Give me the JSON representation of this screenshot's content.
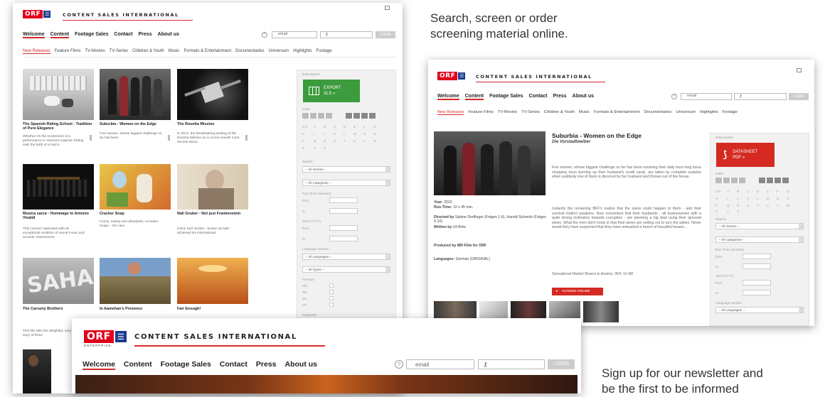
{
  "promo": {
    "top_text_1": "Search, screen or order",
    "top_text_2": "screening material online.",
    "bottom_text_1": "Sign up for our newsletter and",
    "bottom_text_2": "be the first to be informed"
  },
  "brand": {
    "orf": "ORF",
    "enterprise": "ENTERPRISE",
    "name": "CONTENT SALES INTERNATIONAL"
  },
  "nav": {
    "items": [
      "Welcome",
      "Content",
      "Footage Sales",
      "Contact",
      "Press",
      "About us"
    ],
    "email_placeholder": "email",
    "login": "LOGIN"
  },
  "subnav": [
    "New Releases",
    "Feature Films",
    "TV-Movies",
    "TV-Series",
    "Children & Youth",
    "Music",
    "Formats & Entertainment",
    "Documentaries",
    "Universum",
    "Highlights",
    "Footage"
  ],
  "grid": {
    "items": [
      {
        "title": "The Spanish Riding School - Tradition of Pure Elegance",
        "desc": "Whether it's the excitement of a performance in Vienna's majestic Riding Hall, the birth of a foal in"
      },
      {
        "title": "Suburbia - Women on the Edge",
        "desc": "Five women, whose biggest challenge so far has been"
      },
      {
        "title": "The Rosetta Mission",
        "desc": "In 2014, the breathtaking landing of the Rosetta Mission on a comet unveils most secrets about"
      },
      {
        "title": "Musica sacra - Hommage to Antonio Vivaldi",
        "desc": "This concert captivates with its exceptional rendition of sacral music and acoustic impressions."
      },
      {
        "title": "Cracker Snap",
        "desc": "Funny, messy and absolutely «Cracker Snap» - the new"
      },
      {
        "title": "Nali Gruber - Not just Frankenstein",
        "desc": "Heinz Karl Gruber - known as Nali - achieved his international"
      },
      {
        "title": "The Carsony Brothers",
        "desc": "This film tells the delightful, very moving story of three"
      },
      {
        "title": "In Aamshan's Presence",
        "desc": ""
      },
      {
        "title": "Fair Enough!",
        "desc": ""
      }
    ]
  },
  "sidebar": {
    "data_export": "Data Export",
    "export_label": "EXPORT",
    "export_sub": "XLS »",
    "index": "Index",
    "letters": [
      "0-9",
      "A",
      "B",
      "C",
      "D",
      "E",
      "F",
      "G",
      "H",
      "I",
      "J",
      "K",
      "L",
      "M",
      "N",
      "O",
      "P",
      "Q",
      "R",
      "S",
      "T",
      "U",
      "V",
      "W",
      "X",
      "Y",
      "Z"
    ],
    "search": "Search",
    "all_genres": "-- All Genres --",
    "all_categories": "-- All Categories --",
    "run_time": "Run Time (minutes)",
    "from": "from",
    "to": "to",
    "year": "Year (YYYY)",
    "language_version": "Language Version",
    "all_languages": "-- All Languages --",
    "all_types": "-- All Types --",
    "formats": "Formats",
    "hd": "HD:",
    "sd": "SD:",
    "4k": "4K:",
    "ut": "UT:",
    "keywords": "Keywords"
  },
  "detail": {
    "title": "Suburbia - Women on the Edge",
    "subtitle": "Die Vorstadtweiber",
    "year_label": "Year:",
    "year": "2015",
    "runtime_label": "Run-Time:",
    "runtime": "10 x 45 min.",
    "directed": "Directed by",
    "directed_val": "Sabine Derflinger (Folgen 1-6), Harald Sicheritz (Folgen 6-10)",
    "written": "Written by",
    "written_val": "Uli Brée",
    "produced": "Produced by MR-Film for ORF",
    "languages_label": "Languages:",
    "languages": "German (ORIGINAL)",
    "para1": "Five women, whose biggest challenge so far has been surviving their daily hour-long luxus shopping tours burning up their husband's credit cards, are taken by complete surprise when suddenly one of them is divorced by her husband and thrown out of the house.",
    "para2": "Instantly the remaining BFF's realize that the same could happen to them - and their survival instinct awakens. How convenient that their husbands - all businessmen with a quite strong inclination towards corruption - are planning a big deal using their ignorant wives. What the men don't know is that their wives are setting out to turn the tables: Never would they have suspected that they have unleashed a bunch of beautiful beasts...",
    "market_share": "Sensational Market Shares in Austria: 36% 12-49!",
    "screen_online": "SCREEN ONLINE",
    "datasheet": "DATASHEET",
    "datasheet_sub": "PDF »"
  },
  "colors": {
    "accent": "#d62a2a",
    "green": "#3c9b3c",
    "orf_blue": "#1a3d8f"
  }
}
